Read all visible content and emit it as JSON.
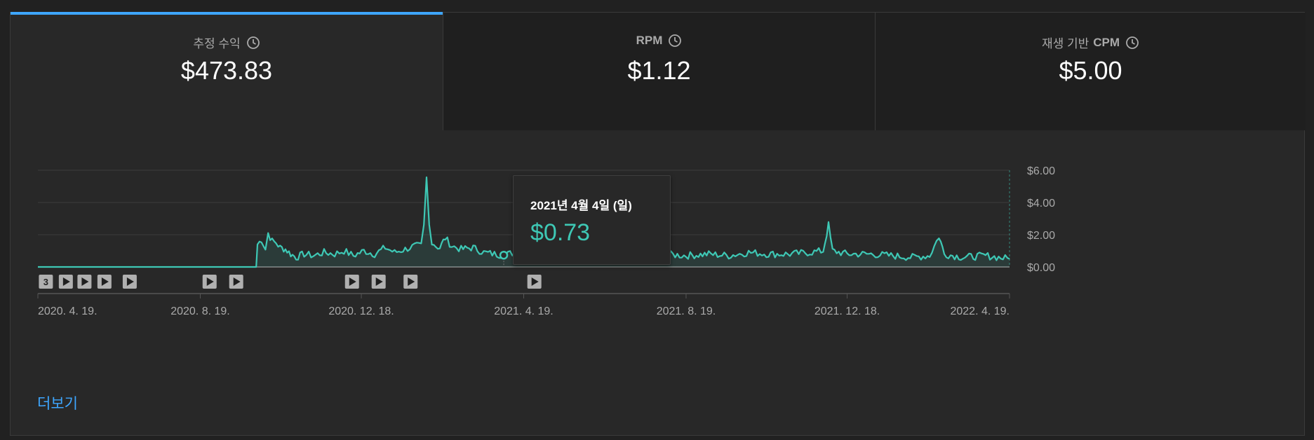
{
  "tabs": [
    {
      "label": "추정 수익",
      "value": "$473.83",
      "active": true
    },
    {
      "label": "RPM",
      "value": "$1.12",
      "active": false
    },
    {
      "label_prefix": "재생 기반",
      "label": "CPM",
      "value": "$5.00",
      "active": false
    }
  ],
  "tooltip": {
    "date": "2021년 4월 4일 (일)",
    "value": "$0.73"
  },
  "more_link": "더보기",
  "colors": {
    "accent": "#3ea6ff",
    "series": "#3ec8b5",
    "background": "#282828"
  },
  "chart_data": {
    "type": "area",
    "x_tick_labels": [
      "2020. 4. 19.",
      "2020. 8. 19.",
      "2020. 12. 18.",
      "2021. 4. 19.",
      "2021. 8. 19.",
      "2021. 12. 18.",
      "2022. 4. 19."
    ],
    "y_tick_labels": [
      "$6.00",
      "$4.00",
      "$2.00",
      "$0.00"
    ],
    "ylim": [
      0,
      6
    ],
    "xlim": [
      "2020-04-19",
      "2022-04-19"
    ],
    "grid": true,
    "series": [
      {
        "values": [
          [
            "2020-04-19",
            0.0
          ],
          [
            "2020-06-19",
            0.0
          ],
          [
            "2020-08-19",
            0.0
          ],
          [
            "2020-09-30",
            0.0
          ],
          [
            "2020-10-01",
            1.4
          ],
          [
            "2020-10-04",
            1.7
          ],
          [
            "2020-10-07",
            1.1
          ],
          [
            "2020-10-09",
            2.1
          ],
          [
            "2020-10-12",
            1.6
          ],
          [
            "2020-10-15",
            1.5
          ],
          [
            "2020-10-18",
            1.2
          ],
          [
            "2020-10-22",
            1.1
          ],
          [
            "2020-10-26",
            0.8
          ],
          [
            "2020-10-30",
            0.6
          ],
          [
            "2020-11-05",
            0.8
          ],
          [
            "2020-11-12",
            0.7
          ],
          [
            "2020-11-20",
            0.9
          ],
          [
            "2020-11-28",
            0.8
          ],
          [
            "2020-12-05",
            1.0
          ],
          [
            "2020-12-12",
            0.7
          ],
          [
            "2020-12-20",
            1.0
          ],
          [
            "2020-12-28",
            0.8
          ],
          [
            "2021-01-05",
            1.2
          ],
          [
            "2021-01-12",
            0.9
          ],
          [
            "2021-01-20",
            1.1
          ],
          [
            "2021-01-27",
            1.3
          ],
          [
            "2021-02-01",
            1.3
          ],
          [
            "2021-02-03",
            2.5
          ],
          [
            "2021-02-05",
            5.5
          ],
          [
            "2021-02-07",
            2.6
          ],
          [
            "2021-02-09",
            1.6
          ],
          [
            "2021-02-12",
            1.3
          ],
          [
            "2021-02-15",
            1.2
          ],
          [
            "2021-02-19",
            1.8
          ],
          [
            "2021-02-24",
            1.3
          ],
          [
            "2021-03-03",
            1.1
          ],
          [
            "2021-03-12",
            1.2
          ],
          [
            "2021-03-20",
            0.9
          ],
          [
            "2021-03-28",
            0.8
          ],
          [
            "2021-04-04",
            0.73
          ],
          [
            "2021-04-12",
            0.9
          ],
          [
            "2021-04-20",
            1.0
          ],
          [
            "2021-05-01",
            0.8
          ],
          [
            "2021-05-10",
            1.1
          ],
          [
            "2021-05-20",
            0.7
          ],
          [
            "2021-06-01",
            0.9
          ],
          [
            "2021-06-15",
            0.7
          ],
          [
            "2021-07-01",
            0.8
          ],
          [
            "2021-07-15",
            0.7
          ],
          [
            "2021-08-01",
            0.8
          ],
          [
            "2021-08-19",
            0.7
          ],
          [
            "2021-09-05",
            0.8
          ],
          [
            "2021-09-20",
            0.7
          ],
          [
            "2021-10-05",
            0.9
          ],
          [
            "2021-10-20",
            0.8
          ],
          [
            "2021-11-05",
            0.8
          ],
          [
            "2021-11-20",
            0.9
          ],
          [
            "2021-11-30",
            1.0
          ],
          [
            "2021-12-04",
            2.6
          ],
          [
            "2021-12-07",
            1.0
          ],
          [
            "2021-12-18",
            0.8
          ],
          [
            "2022-01-05",
            0.8
          ],
          [
            "2022-01-20",
            0.7
          ],
          [
            "2022-02-05",
            0.6
          ],
          [
            "2022-02-18",
            0.7
          ],
          [
            "2022-02-25",
            1.9
          ],
          [
            "2022-03-01",
            0.8
          ],
          [
            "2022-03-15",
            0.6
          ],
          [
            "2022-04-01",
            0.7
          ],
          [
            "2022-04-19",
            0.5
          ]
        ]
      }
    ],
    "highlight_point": [
      "2021-04-04",
      0.73
    ],
    "annotation_markers": [
      {
        "date": "2020-04-25",
        "label": "3"
      },
      {
        "date": "2020-05-10"
      },
      {
        "date": "2020-05-24"
      },
      {
        "date": "2020-06-08"
      },
      {
        "date": "2020-06-27"
      },
      {
        "date": "2020-08-26"
      },
      {
        "date": "2020-09-15"
      },
      {
        "date": "2020-12-11"
      },
      {
        "date": "2020-12-31"
      },
      {
        "date": "2021-01-24"
      },
      {
        "date": "2021-04-27"
      }
    ]
  }
}
